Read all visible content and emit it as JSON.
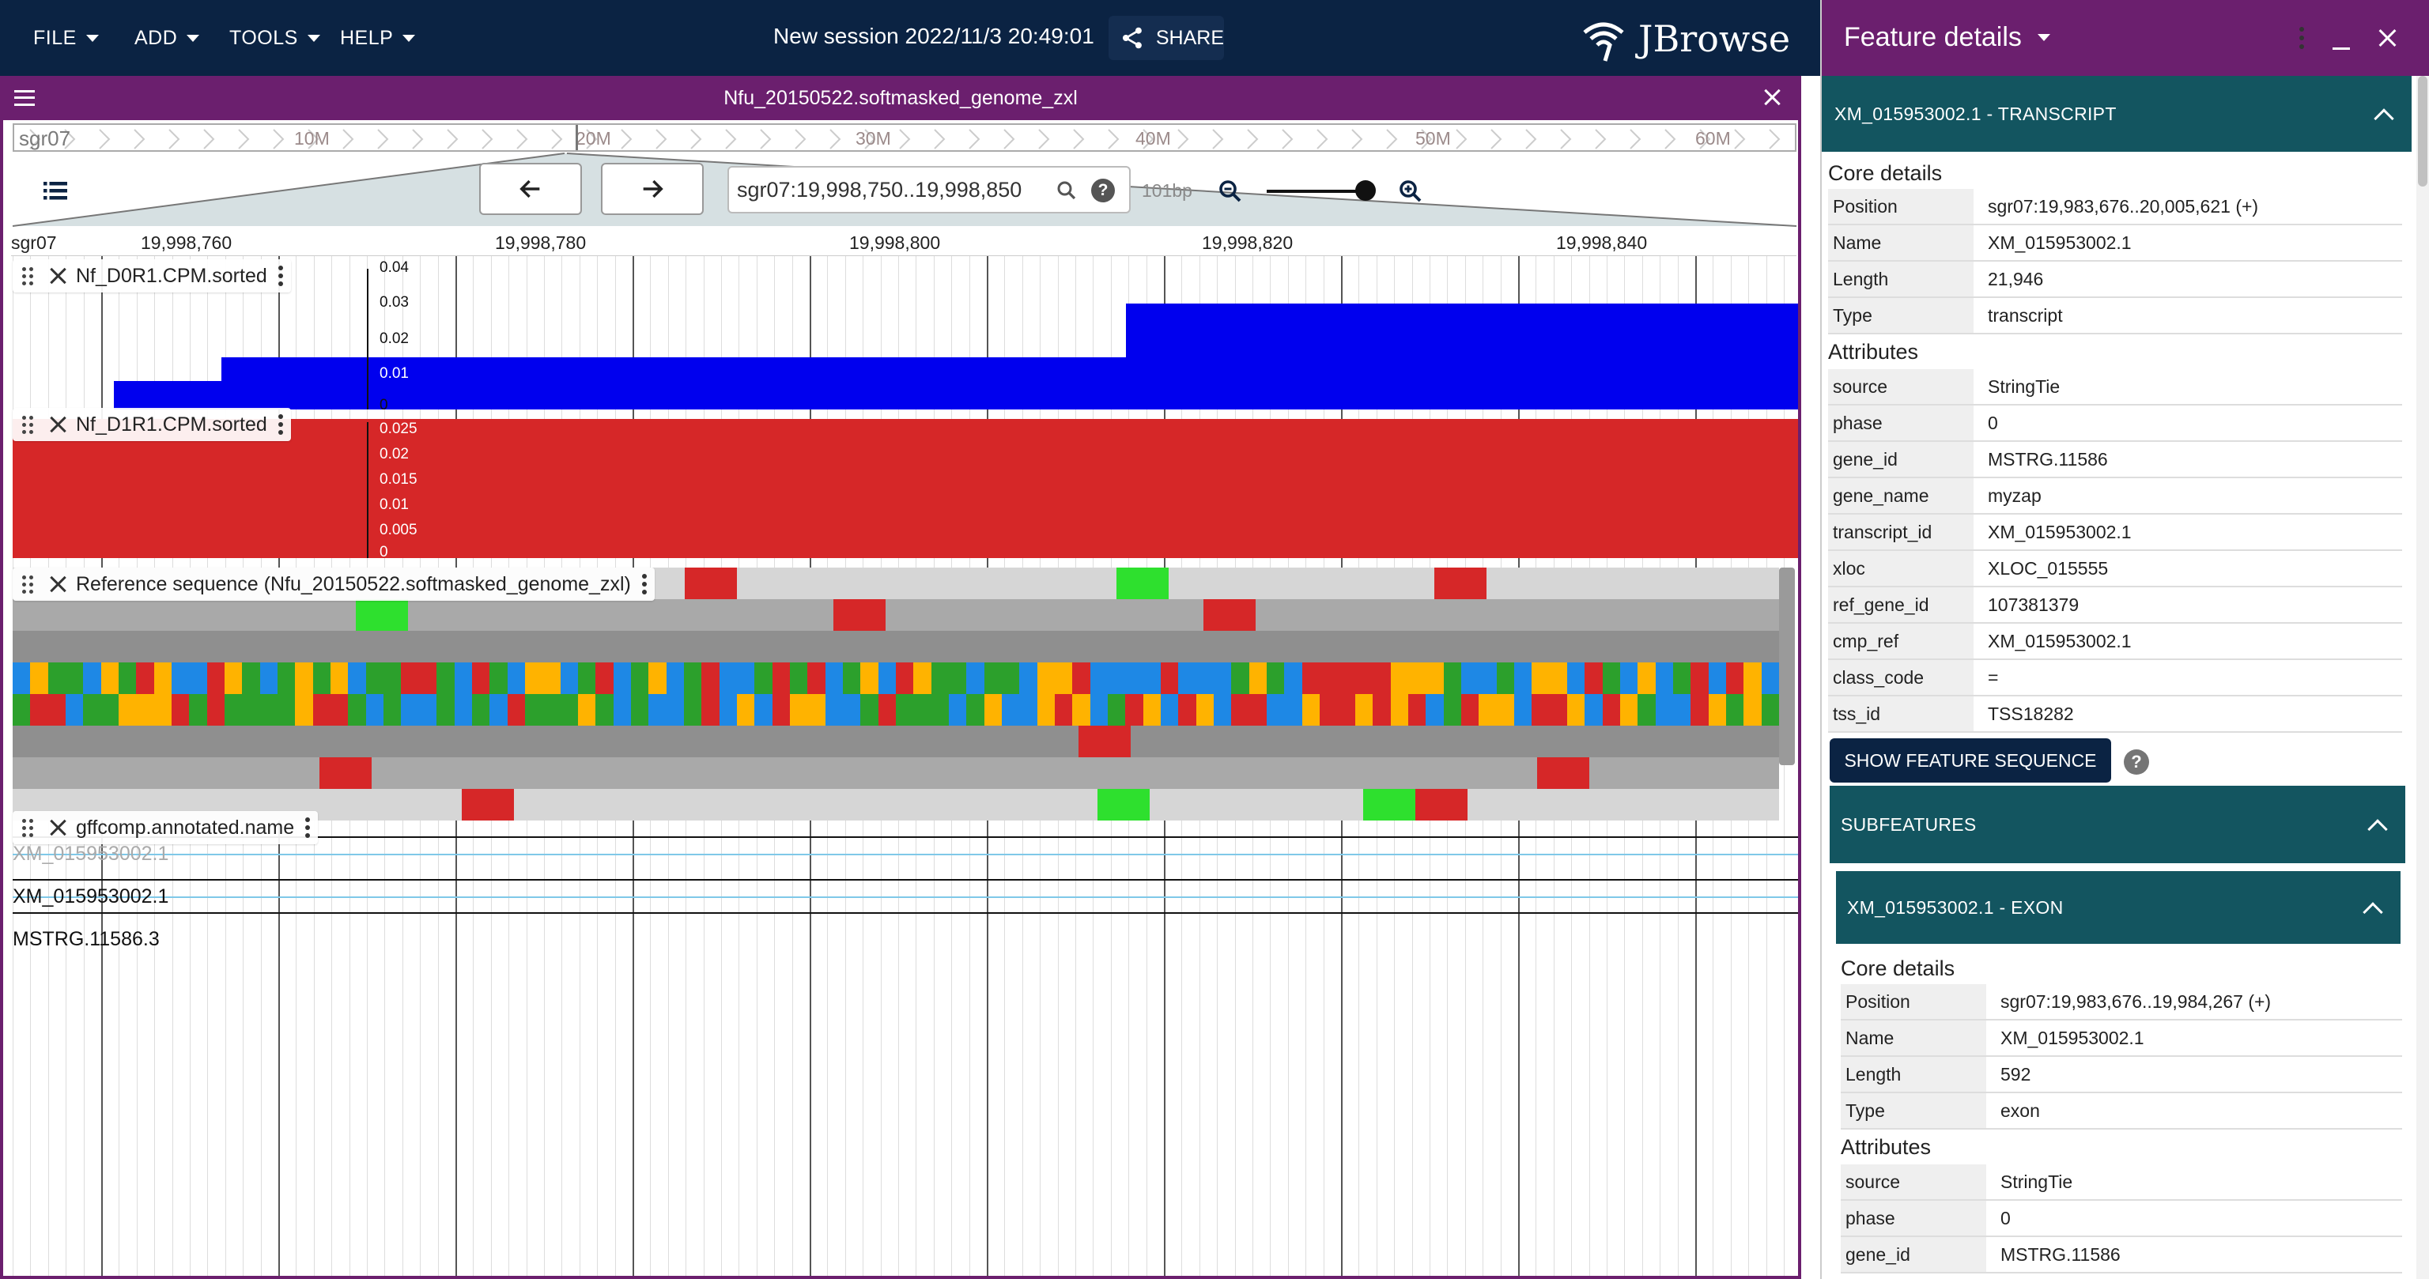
{
  "menus": [
    "FILE",
    "ADD",
    "TOOLS",
    "HELP"
  ],
  "session_title": "New session 2022/11/3 20:49:01",
  "share_label": "SHARE",
  "logo_text": "JBrowse",
  "view": {
    "assembly": "Nfu_20150522.softmasked_genome_zxl",
    "overview_ref": "sgr07",
    "overview_ticks": [
      "10M",
      "20M",
      "30M",
      "40M",
      "50M",
      "60M"
    ],
    "location": "sgr07:19,998,750..19,998,850",
    "bp_per_view": "101bp",
    "ruler_ref": "sgr07",
    "ruler_ticks": [
      "19,998,760",
      "19,998,780",
      "19,998,800",
      "19,998,820",
      "19,998,840"
    ]
  },
  "tracks": [
    {
      "name": "Nf_D0R1.CPM.sorted",
      "axis": [
        "0.04",
        "0.03",
        "0.02",
        "0.01",
        "0"
      ],
      "color": "#0000ee"
    },
    {
      "name": "Nf_D1R1.CPM.sorted",
      "axis": [
        "0.025",
        "0.02",
        "0.015",
        "0.01",
        "0.005",
        "0"
      ],
      "color": "#d62728"
    },
    {
      "name": "Reference sequence (Nfu_20150522.softmasked_genome_zxl)"
    },
    {
      "name": "gffcomp.annotated.name",
      "features": [
        "XM_015953002.1",
        "XM_015953002.1",
        "MSTRG.11586.3"
      ]
    }
  ],
  "drawer": {
    "title": "Feature details",
    "main_header": "XM_015953002.1 - TRANSCRIPT",
    "core_label": "Core details",
    "core": [
      [
        "Position",
        "sgr07:19,983,676..20,005,621 (+)"
      ],
      [
        "Name",
        "XM_015953002.1"
      ],
      [
        "Length",
        "21,946"
      ],
      [
        "Type",
        "transcript"
      ]
    ],
    "attr_label": "Attributes",
    "attributes": [
      [
        "source",
        "StringTie"
      ],
      [
        "phase",
        "0"
      ],
      [
        "gene_id",
        "MSTRG.11586"
      ],
      [
        "gene_name",
        "myzap"
      ],
      [
        "transcript_id",
        "XM_015953002.1"
      ],
      [
        "xloc",
        "XLOC_015555"
      ],
      [
        "ref_gene_id",
        "107381379"
      ],
      [
        "cmp_ref",
        "XM_015953002.1"
      ],
      [
        "class_code",
        "="
      ],
      [
        "tss_id",
        "TSS18282"
      ]
    ],
    "show_seq": "SHOW FEATURE SEQUENCE",
    "help": "?",
    "subfeatures": "SUBFEATURES",
    "exon_header": "XM_015953002.1 - EXON",
    "exon_core_label": "Core details",
    "exon_core": [
      [
        "Position",
        "sgr07:19,983,676..19,984,267 (+)"
      ],
      [
        "Name",
        "XM_015953002.1"
      ],
      [
        "Length",
        "592"
      ],
      [
        "Type",
        "exon"
      ]
    ],
    "exon_attr_label": "Attributes",
    "exon_attributes": [
      [
        "source",
        "StringTie"
      ],
      [
        "phase",
        "0"
      ],
      [
        "gene_id",
        "MSTRG.11586"
      ]
    ]
  }
}
